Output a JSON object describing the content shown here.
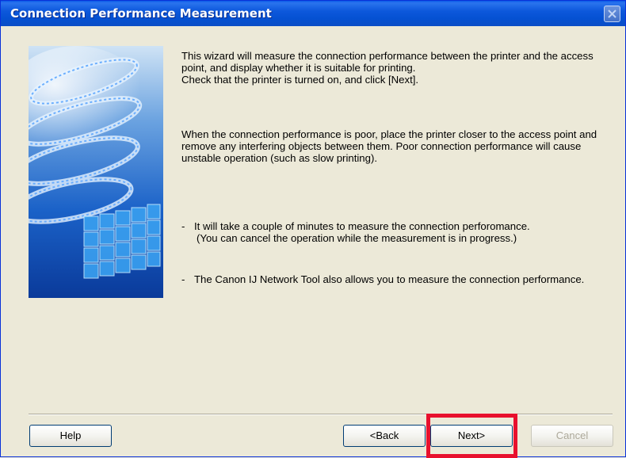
{
  "window": {
    "title": "Connection Performance Measurement",
    "close_icon": "close-icon"
  },
  "content": {
    "intro_1": "This wizard will measure the connection performance between the printer and the access point, and display whether it is suitable for printing.",
    "intro_2": "Check that the printer is turned on, and click [Next].",
    "poor_note": "When the connection performance is poor, place the printer closer to the access point and remove any interfering objects between them. Poor connection performance will cause unstable operation (such as slow printing).",
    "bullets": [
      {
        "dash": "-",
        "line1": "It will take a couple of minutes to measure the connection perforomance.",
        "line2": "(You can cancel the operation while the measurement is in progress.)"
      },
      {
        "dash": "-",
        "line1": "The Canon IJ Network Tool also allows you to measure the connection performance."
      }
    ]
  },
  "buttons": {
    "help": "Help",
    "back": "<Back",
    "next": "Next>",
    "cancel": "Cancel"
  },
  "colors": {
    "highlight": "#e8102e",
    "titlebar": "#0551d2",
    "face": "#ece9d8"
  }
}
